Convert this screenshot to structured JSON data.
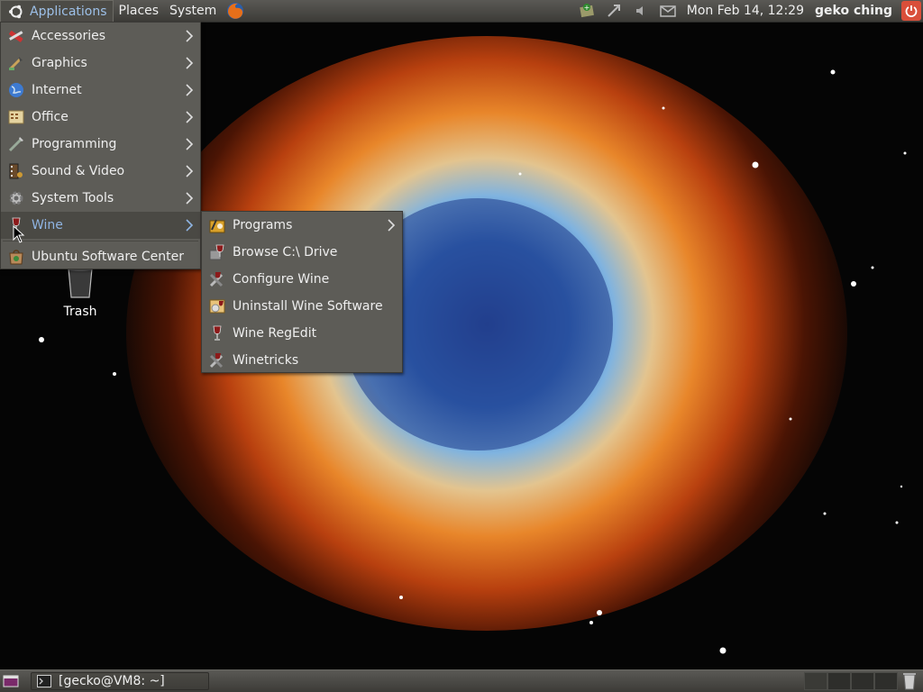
{
  "top_panel": {
    "applications_label": "Applications",
    "places_label": "Places",
    "system_label": "System",
    "clock": "Mon Feb 14, 12:29",
    "user": "geko ching"
  },
  "applications_menu": {
    "items": [
      {
        "label": "Accessories",
        "icon": "accessories-icon",
        "submenu": true
      },
      {
        "label": "Graphics",
        "icon": "graphics-icon",
        "submenu": true
      },
      {
        "label": "Internet",
        "icon": "internet-globe-icon",
        "submenu": true
      },
      {
        "label": "Office",
        "icon": "office-icon",
        "submenu": true
      },
      {
        "label": "Programming",
        "icon": "programming-icon",
        "submenu": true
      },
      {
        "label": "Sound & Video",
        "icon": "sound-video-icon",
        "submenu": true
      },
      {
        "label": "System Tools",
        "icon": "gear-icon",
        "submenu": true
      },
      {
        "label": "Wine",
        "icon": "wine-glass-icon",
        "submenu": true,
        "highlighted": true
      },
      {
        "label": "Ubuntu Software Center",
        "icon": "software-center-icon",
        "submenu": false
      }
    ]
  },
  "wine_submenu": {
    "items": [
      {
        "label": "Programs",
        "icon": "programs-folder-icon",
        "submenu": true
      },
      {
        "label": "Browse C:\\ Drive",
        "icon": "wine-glass-icon",
        "submenu": false
      },
      {
        "label": "Configure Wine",
        "icon": "wine-config-icon",
        "submenu": false
      },
      {
        "label": "Uninstall Wine Software",
        "icon": "uninstall-icon",
        "submenu": false
      },
      {
        "label": "Wine RegEdit",
        "icon": "wine-glass-icon",
        "submenu": false
      },
      {
        "label": "Winetricks",
        "icon": "winetricks-icon",
        "submenu": false
      }
    ]
  },
  "desktop": {
    "trash_label": "Trash"
  },
  "bottom_panel": {
    "task_label": "[gecko@VM8: ~]",
    "workspace_count": 4,
    "active_workspace": 1
  },
  "colors": {
    "panel": "#4a4944",
    "menu_bg": "#5d5c57",
    "highlight_text": "#8fb4e2",
    "power": "#d94f3a"
  }
}
